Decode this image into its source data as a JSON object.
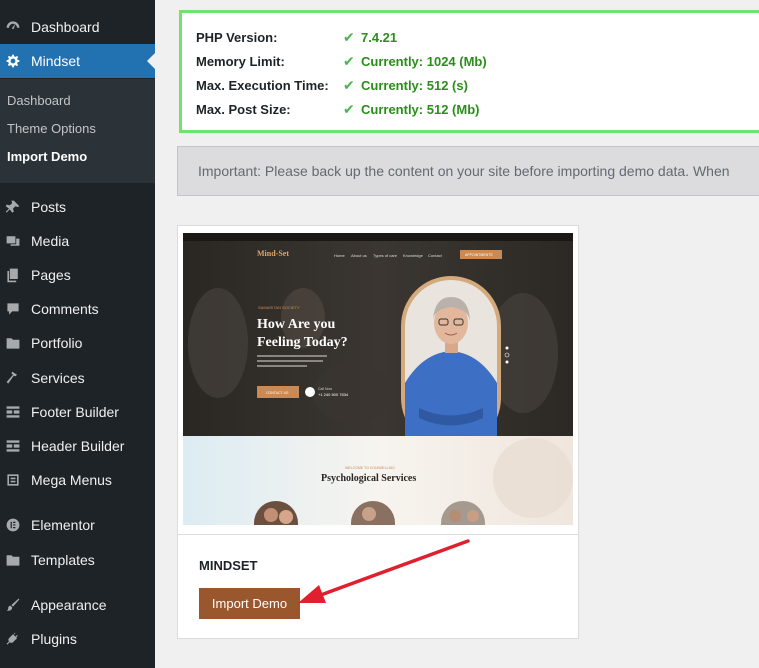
{
  "sidebar": {
    "items": [
      {
        "label": "Dashboard",
        "icon": "dashboard-icon"
      },
      {
        "label": "Mindset",
        "icon": "gear-icon",
        "active": true
      },
      {
        "label": "Posts",
        "icon": "pin-icon"
      },
      {
        "label": "Media",
        "icon": "media-icon"
      },
      {
        "label": "Pages",
        "icon": "pages-icon"
      },
      {
        "label": "Comments",
        "icon": "comment-icon"
      },
      {
        "label": "Portfolio",
        "icon": "folder-icon"
      },
      {
        "label": "Services",
        "icon": "hammer-icon"
      },
      {
        "label": "Footer Builder",
        "icon": "layout-icon"
      },
      {
        "label": "Header Builder",
        "icon": "layout-icon"
      },
      {
        "label": "Mega Menus",
        "icon": "menu-icon"
      },
      {
        "label": "Elementor",
        "icon": "elementor-icon"
      },
      {
        "label": "Templates",
        "icon": "folder-icon"
      },
      {
        "label": "Appearance",
        "icon": "brush-icon"
      },
      {
        "label": "Plugins",
        "icon": "plug-icon"
      }
    ],
    "submenu": [
      {
        "label": "Dashboard"
      },
      {
        "label": "Theme Options"
      },
      {
        "label": "Import Demo",
        "current": true
      }
    ]
  },
  "server": {
    "rows": [
      {
        "label": "PHP Version:",
        "value": "7.4.21"
      },
      {
        "label": "Memory Limit:",
        "value": "Currently: 1024 (Mb)"
      },
      {
        "label": "Max. Execution Time:",
        "value": "Currently: 512 (s)"
      },
      {
        "label": "Max. Post Size:",
        "value": "Currently: 512 (Mb)"
      }
    ]
  },
  "notice": {
    "text": "Important: Please back up the content on your site before importing demo data. When"
  },
  "demo": {
    "name": "MINDSET",
    "button_label": "Import Demo",
    "preview": {
      "logo": "Mind-Set",
      "nav": [
        "Home",
        "About us",
        "Types of care",
        "Knowledge",
        "Contact"
      ],
      "cta": "APPOINTMENTS",
      "kicker": "SAMARITAN SOCIETY",
      "headline_1": "How Are you",
      "headline_2": "Feeling Today?",
      "contact_btn": "CONTACT US",
      "phone_label": "Call Now",
      "phone": "+1 240 500 7834",
      "services_kicker": "WELCOME TO COUNSELLING",
      "services_title": "Psychological Services"
    }
  },
  "colors": {
    "sidebar_bg": "#1d2327",
    "active_bg": "#2271b1",
    "button_bg": "#9a572d",
    "check_green": "#46b450",
    "arrow_red": "#e0202e"
  }
}
